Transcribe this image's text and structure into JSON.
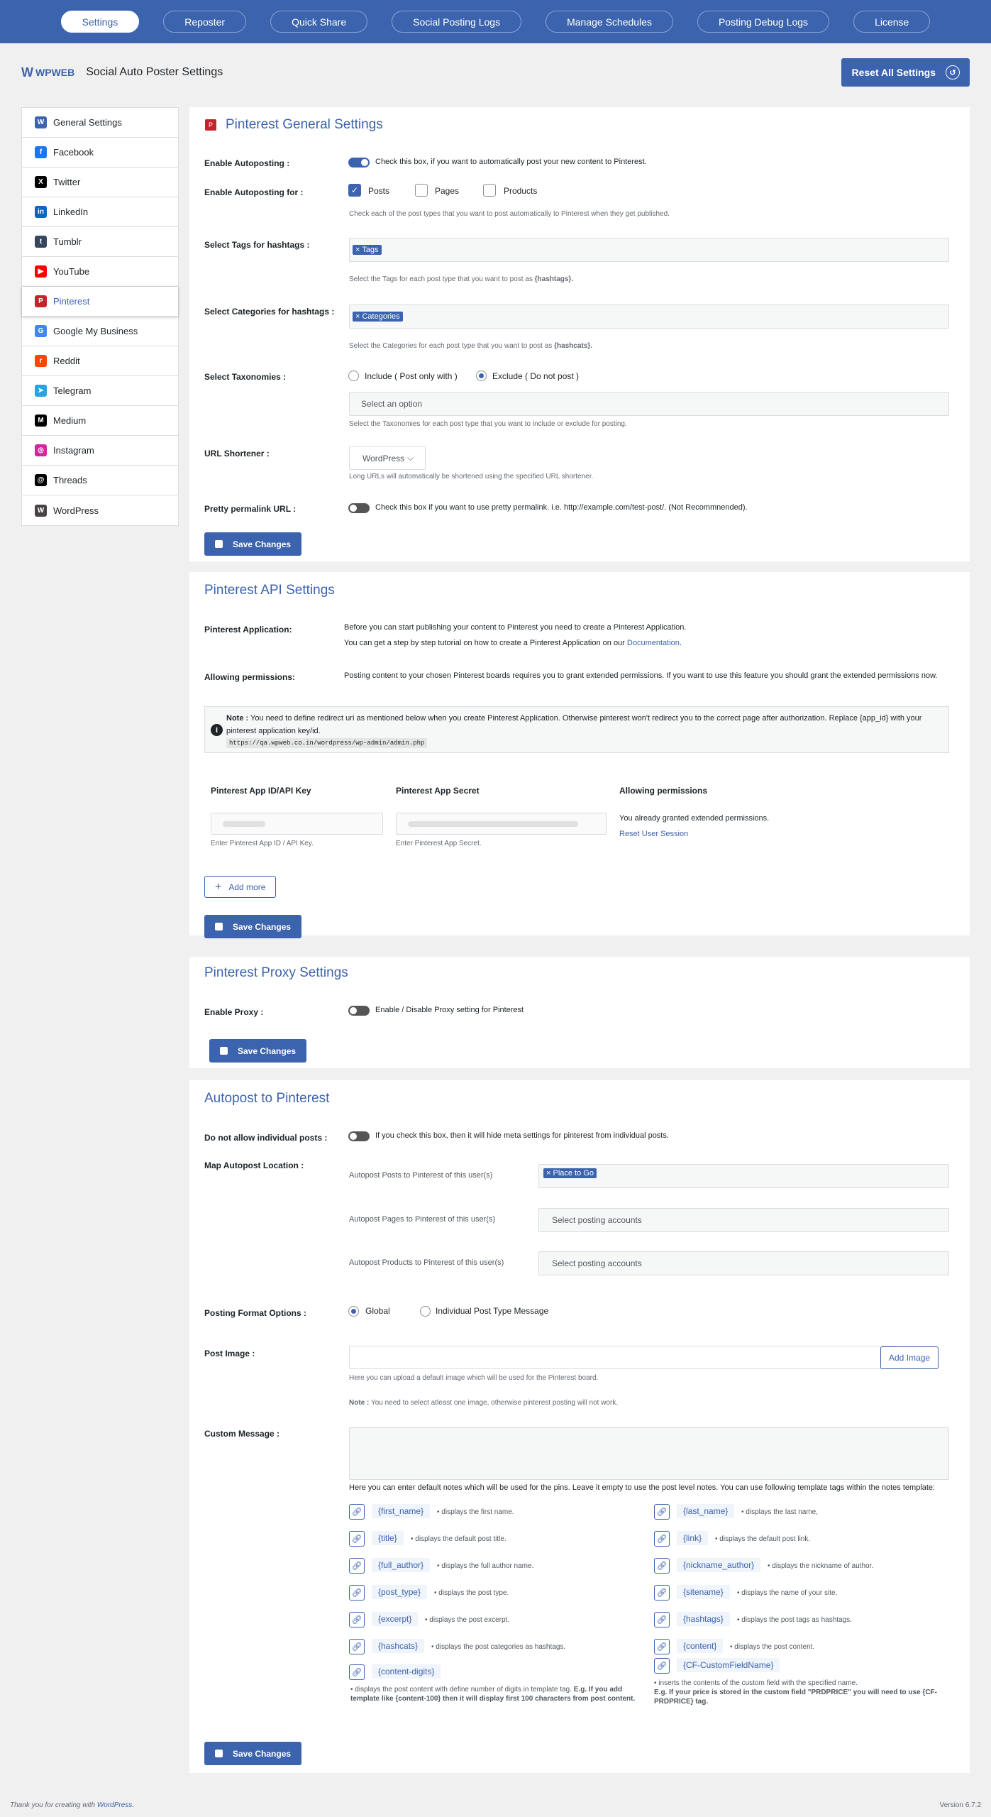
{
  "nav": {
    "tabs": [
      "Settings",
      "Reposter",
      "Quick Share",
      "Social Posting Logs",
      "Manage Schedules",
      "Posting Debug Logs",
      "License"
    ]
  },
  "header": {
    "logo": "WPWEB",
    "title": "Social Auto Poster Settings",
    "reset": "Reset All Settings"
  },
  "sidebar": {
    "items": [
      {
        "label": "General Settings",
        "icon": "W",
        "color": "#3c63ad"
      },
      {
        "label": "Facebook",
        "icon": "f",
        "color": "#1877f2"
      },
      {
        "label": "Twitter",
        "icon": "X",
        "color": "#000000"
      },
      {
        "label": "LinkedIn",
        "icon": "in",
        "color": "#0a66c2"
      },
      {
        "label": "Tumblr",
        "icon": "t",
        "color": "#36465d"
      },
      {
        "label": "YouTube",
        "icon": "▶",
        "color": "#ff0000"
      },
      {
        "label": "Pinterest",
        "icon": "P",
        "color": "#c8232c"
      },
      {
        "label": "Google My Business",
        "icon": "G",
        "color": "#4285f4"
      },
      {
        "label": "Reddit",
        "icon": "r",
        "color": "#ff4500"
      },
      {
        "label": "Telegram",
        "icon": "➤",
        "color": "#2aa3de"
      },
      {
        "label": "Medium",
        "icon": "M",
        "color": "#000000"
      },
      {
        "label": "Instagram",
        "icon": "◎",
        "color": "#d6249f"
      },
      {
        "label": "Threads",
        "icon": "@",
        "color": "#000000"
      },
      {
        "label": "WordPress",
        "icon": "W",
        "color": "#464342"
      }
    ]
  },
  "general": {
    "title": "Pinterest General Settings",
    "enable_label": "Enable Autoposting :",
    "enable_desc": "Check this box, if you want to automatically post your new content to Pinterest.",
    "for_label": "Enable Autoposting for :",
    "opt_posts": "Posts",
    "opt_pages": "Pages",
    "opt_products": "Products",
    "for_desc": "Check each of the post types that you want to post automatically to Pinterest when they get published.",
    "tags_label": "Select Tags for hashtags :",
    "tags_chip": "Tags",
    "tags_desc_a": "Select the Tags for each post type that you want to post as ",
    "tags_desc_b": "{hashtags}.",
    "cats_label": "Select Categories for hashtags :",
    "cats_chip": "Categories",
    "cats_desc_a": "Select the Categories for each post type that you want to post as ",
    "cats_desc_b": "{hashcats}.",
    "tax_label": "Select Taxonomies :",
    "tax_include": "Include ( Post only with )",
    "tax_exclude": "Exclude ( Do not post )",
    "tax_placeholder": "Select an option",
    "tax_desc": "Select the Taxonomies for each post type that you want to include or exclude for posting.",
    "url_label": "URL Shortener :",
    "url_value": "WordPress",
    "url_desc": "Long URLs will automatically be shortened using the specified URL shortener.",
    "perma_label": "Pretty permalink URL :",
    "perma_desc": "Check this box if you want to use pretty permalink. i.e. http://example.com/test-post/. (Not Recommnended).",
    "save": "Save Changes"
  },
  "api": {
    "title": "Pinterest API Settings",
    "app_label": "Pinterest Application:",
    "app_line1": "Before you can start publishing your content to Pinterest you need to create a Pinterest Application.",
    "app_line2a": "You can get a step by step tutorial on how to create a Pinterest Application on our ",
    "app_link": "Documentation",
    "app_line2b": ".",
    "perm_label": "Allowing permissions:",
    "perm_desc": "Posting content to your chosen Pinterest boards requires you to grant extended permissions. If you want to use this feature you should grant the extended permissions now.",
    "note_b": "Note :",
    "note_text": " You need to define redirect uri as mentioned below when you create Pinterest Application. Otherwise pinterest won't redirect you to the correct page after authorization. Replace {app_id} with your pinterest application key/id.",
    "note_url": "https://qa.wpweb.co.in/wordpress/wp-admin/admin.php",
    "col1": "Pinterest App ID/API Key",
    "col2": "Pinterest App Secret",
    "col3": "Allowing permissions",
    "col1_desc": "Enter Pinterest App ID / API Key.",
    "col2_desc": "Enter Pinterest App Secret.",
    "granted": "You already granted extended permissions.",
    "reset_session": "Reset User Session",
    "add_more": "Add more",
    "save": "Save Changes"
  },
  "proxy": {
    "title": "Pinterest Proxy Settings",
    "label": "Enable Proxy :",
    "desc": "Enable / Disable Proxy setting for Pinterest",
    "save": "Save Changes"
  },
  "autopost": {
    "title": "Autopost to Pinterest",
    "indiv_label": "Do not allow individual posts :",
    "indiv_desc": "If you check this box, then it will hide meta settings for pinterest from individual posts.",
    "map_label": "Map Autopost Location :",
    "map_posts": "Autopost Posts to Pinterest of this user(s)",
    "map_posts_chip": "Place to Go",
    "map_pages": "Autopost Pages to Pinterest of this user(s)",
    "map_pages_ph": "Select posting accounts",
    "map_products": "Autopost Products to Pinterest of this user(s)",
    "map_products_ph": "Select posting accounts",
    "format_label": "Posting Format Options :",
    "format_global": "Global",
    "format_individual": "Individual Post Type Message",
    "image_label": "Post Image :",
    "add_image": "Add Image",
    "image_desc": "Here you can upload a default image which will be used for the Pinterest board.",
    "image_note_b": "Note :",
    "image_note": " You need to select atleast one image, otherwise pinterest posting will not work.",
    "msg_label": "Custom Message :",
    "msg_desc": "Here you can enter default notes which will be used for the pins. Leave it empty to use the post level notes. You can use following template tags within the notes template:",
    "tags_left": [
      {
        "tag": "{first_name}",
        "desc": "displays the first name."
      },
      {
        "tag": "{title}",
        "desc": "displays the default post title."
      },
      {
        "tag": "{full_author}",
        "desc": "displays the full author name."
      },
      {
        "tag": "{post_type}",
        "desc": "displays the post type."
      },
      {
        "tag": "{excerpt}",
        "desc": "displays the post excerpt."
      },
      {
        "tag": "{hashcats}",
        "desc": "displays the post categories as hashtags."
      }
    ],
    "tags_right": [
      {
        "tag": "{last_name}",
        "desc": "displays the last name,"
      },
      {
        "tag": "{link}",
        "desc": "displays the default post link."
      },
      {
        "tag": "{nickname_author}",
        "desc": "displays the nickname of author."
      },
      {
        "tag": "{sitename}",
        "desc": "displays the name of your site."
      },
      {
        "tag": "{hashtags}",
        "desc": "displays the post tags as hashtags."
      },
      {
        "tag": "{content}",
        "desc": "displays the post content."
      }
    ],
    "digits_tag": "{content-digits}",
    "digits_desc_a": "displays the post content with define number of digits in template tag. ",
    "digits_desc_b": "E.g. If you add template like {content-100} then it will display first 100 characters from post content.",
    "cf_tag": "{CF-CustomFieldName}",
    "cf_desc_a": "inserts the contents of the custom field with the specified name.",
    "cf_desc_b": "E.g. If your price is stored in the custom field \"PRDPRICE\" you will need to use {CF-PRDPRICE} tag.",
    "save": "Save Changes"
  },
  "footer": {
    "left_a": "Thank you for creating with ",
    "left_link": "WordPress",
    "left_b": ".",
    "version": "Version 6.7.2"
  }
}
